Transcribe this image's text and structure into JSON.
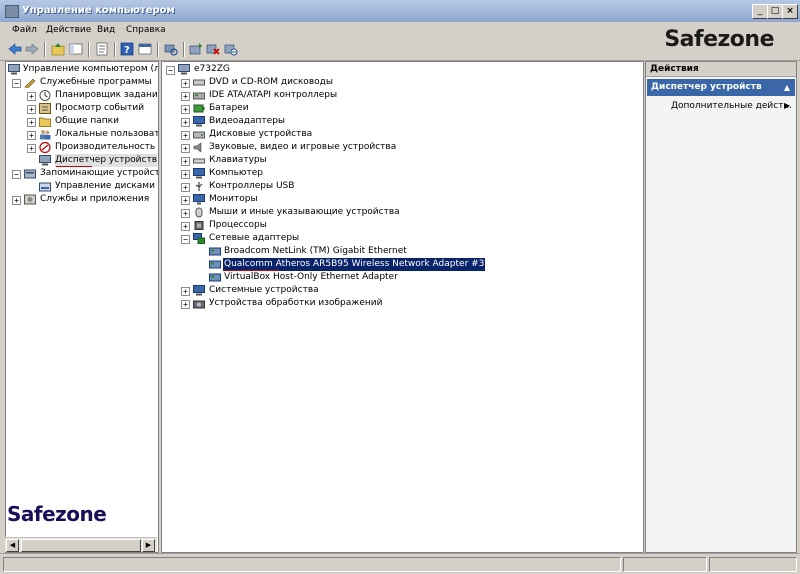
{
  "window": {
    "title": "Управление компьютером",
    "minimize": "_",
    "maximize": "□",
    "close": "×"
  },
  "menu": [
    "Файл",
    "Действие",
    "Вид",
    "Справка"
  ],
  "watermark": "Safezone",
  "left_tree": {
    "root": "Управление компьютером (лока",
    "items": [
      {
        "label": "Служебные программы",
        "level": 1,
        "expander": "−"
      },
      {
        "label": "Планировщик заданий",
        "level": 2,
        "expander": "+"
      },
      {
        "label": "Просмотр событий",
        "level": 2,
        "expander": "+"
      },
      {
        "label": "Общие папки",
        "level": 2,
        "expander": "+"
      },
      {
        "label": "Локальные пользовател",
        "level": 2,
        "expander": "+"
      },
      {
        "label": "Производительность",
        "level": 2,
        "expander": "+"
      },
      {
        "label": "Диспетчер устройств",
        "level": 2,
        "expander": ""
      },
      {
        "label": "Запоминающие устройства",
        "level": 1,
        "expander": "−"
      },
      {
        "label": "Управление дисками",
        "level": 2,
        "expander": ""
      },
      {
        "label": "Службы и приложения",
        "level": 1,
        "expander": "+"
      }
    ]
  },
  "device_tree": {
    "root": "e732ZG",
    "categories": [
      "DVD и CD-ROM дисководы",
      "IDE ATA/ATAPI контроллеры",
      "Батареи",
      "Видеоадаптеры",
      "Дисковые устройства",
      "Звуковые, видео и игровые устройства",
      "Клавиатуры",
      "Компьютер",
      "Контроллеры USB",
      "Мониторы",
      "Мыши и иные указывающие устройства",
      "Процессоры",
      "Сетевые адаптеры"
    ],
    "network_adapters": [
      "Broadcom NetLink (TM) Gigabit Ethernet",
      "Qualcomm Atheros AR5B95 Wireless Network Adapter #3",
      "VirtualBox Host-Only Ethernet Adapter"
    ],
    "after": [
      "Системные устройства",
      "Устройства обработки изображений"
    ]
  },
  "actions": {
    "title": "Действия",
    "group": "Диспетчер устройств",
    "item": "Дополнительные дейст..."
  }
}
